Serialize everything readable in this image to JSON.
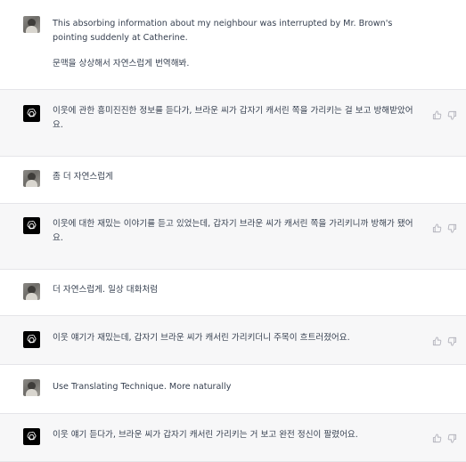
{
  "conversation": [
    {
      "role": "user",
      "lines": [
        "This absorbing information about my neighbour was interrupted by Mr. Brown's pointing suddenly at Catherine.",
        "문맥을 상상해서 자연스럽게 번역해봐."
      ]
    },
    {
      "role": "assistant",
      "lines": [
        "이웃에 관한 흥미진진한 정보를 듣다가, 브라운 씨가 갑자기 캐서린 쪽을 가리키는 걸 보고 방해받았어요."
      ]
    },
    {
      "role": "user",
      "lines": [
        "좀 더 자연스럽게"
      ]
    },
    {
      "role": "assistant",
      "lines": [
        "이웃에 대한 재밌는 이야기를 듣고 있었는데, 갑자기 브라운 씨가 캐서린 쪽을 가리키니까 방해가 됐어요."
      ]
    },
    {
      "role": "user",
      "lines": [
        "더 자연스럽게. 일상 대화처럼"
      ]
    },
    {
      "role": "assistant",
      "lines": [
        "이웃 얘기가 재밌는데, 갑자기 브라운 씨가 캐서린 가리키더니 주목이 흐트러졌어요."
      ]
    },
    {
      "role": "user",
      "lines": [
        "Use Translating Technique. More naturally"
      ]
    },
    {
      "role": "assistant",
      "lines": [
        "이웃 얘기 듣다가, 브라운 씨가 갑자기 캐서린 가리키는 거 보고 완전 정신이 팔렸어요."
      ]
    }
  ],
  "icons": {
    "user_avatar": "user-avatar-photo",
    "assistant_avatar": "openai-logo-icon",
    "like": "thumbs-up-icon",
    "dislike": "thumbs-down-icon"
  },
  "colors": {
    "assistant_bg": "#f7f7f8",
    "user_bg": "#ffffff",
    "divider": "#e5e5e9",
    "text": "#374151",
    "icon": "#b4b4bd"
  }
}
